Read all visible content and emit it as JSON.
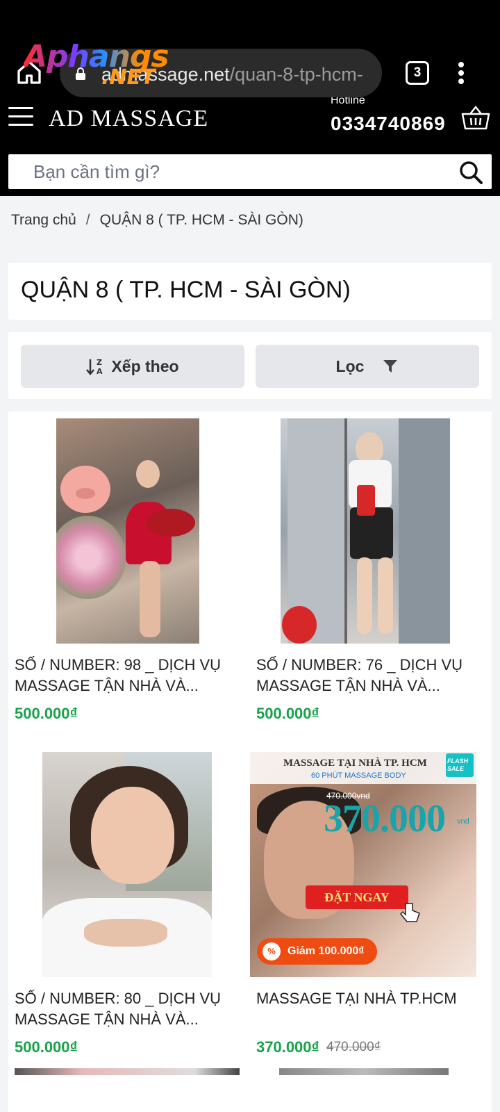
{
  "browser": {
    "tab_count": "3",
    "url_domain": "admassage.net",
    "url_path": "/quan-8-tp-hcm-"
  },
  "watermark": {
    "line1": "Aphangs",
    "line2": ".NET"
  },
  "header": {
    "brand": "AD MASSAGE",
    "hotline_label": "Hotline",
    "hotline": "0334740869"
  },
  "search": {
    "placeholder": "Bạn cần tìm gì?"
  },
  "breadcrumb": {
    "home": "Trang chủ",
    "separator": "/",
    "current": "QUẬN 8 ( TP. HCM - SÀI GÒN)"
  },
  "page": {
    "title": "QUẬN 8 ( TP. HCM - SÀI GÒN)"
  },
  "filters": {
    "sort_label": "Xếp theo",
    "filter_label": "Lọc"
  },
  "products": [
    {
      "name": "SỐ / NUMBER: 98 _ DỊCH VỤ MASSAGE TẬN NHÀ VÀ...",
      "price": "500.000₫"
    },
    {
      "name": "SỐ / NUMBER: 76 _ DỊCH VỤ MASSAGE TẬN NHÀ VÀ...",
      "price": "500.000₫"
    },
    {
      "name": "SỐ / NUMBER: 80 _ DỊCH VỤ MASSAGE TẬN NHÀ VÀ...",
      "price": "500.000₫"
    },
    {
      "name": "MASSAGE TẠI NHÀ TP.HCM",
      "price": "370.000₫",
      "old_price": "470.000₫"
    }
  ],
  "promo": {
    "title": "MASSAGE TẠI NHÀ TP. HCM",
    "subtitle": "60 PHÚT MASSAGE BODY",
    "flash": "FLASH SALE",
    "old_price": "470.000vnd",
    "price": "370.000",
    "unit": "vnd",
    "cta": "ĐẶT NGAY",
    "discount": "Giảm 100.000₫"
  },
  "colors": {
    "price_green": "#16a34a",
    "header_bg": "#000000",
    "discount_orange": "#ef4c12"
  }
}
